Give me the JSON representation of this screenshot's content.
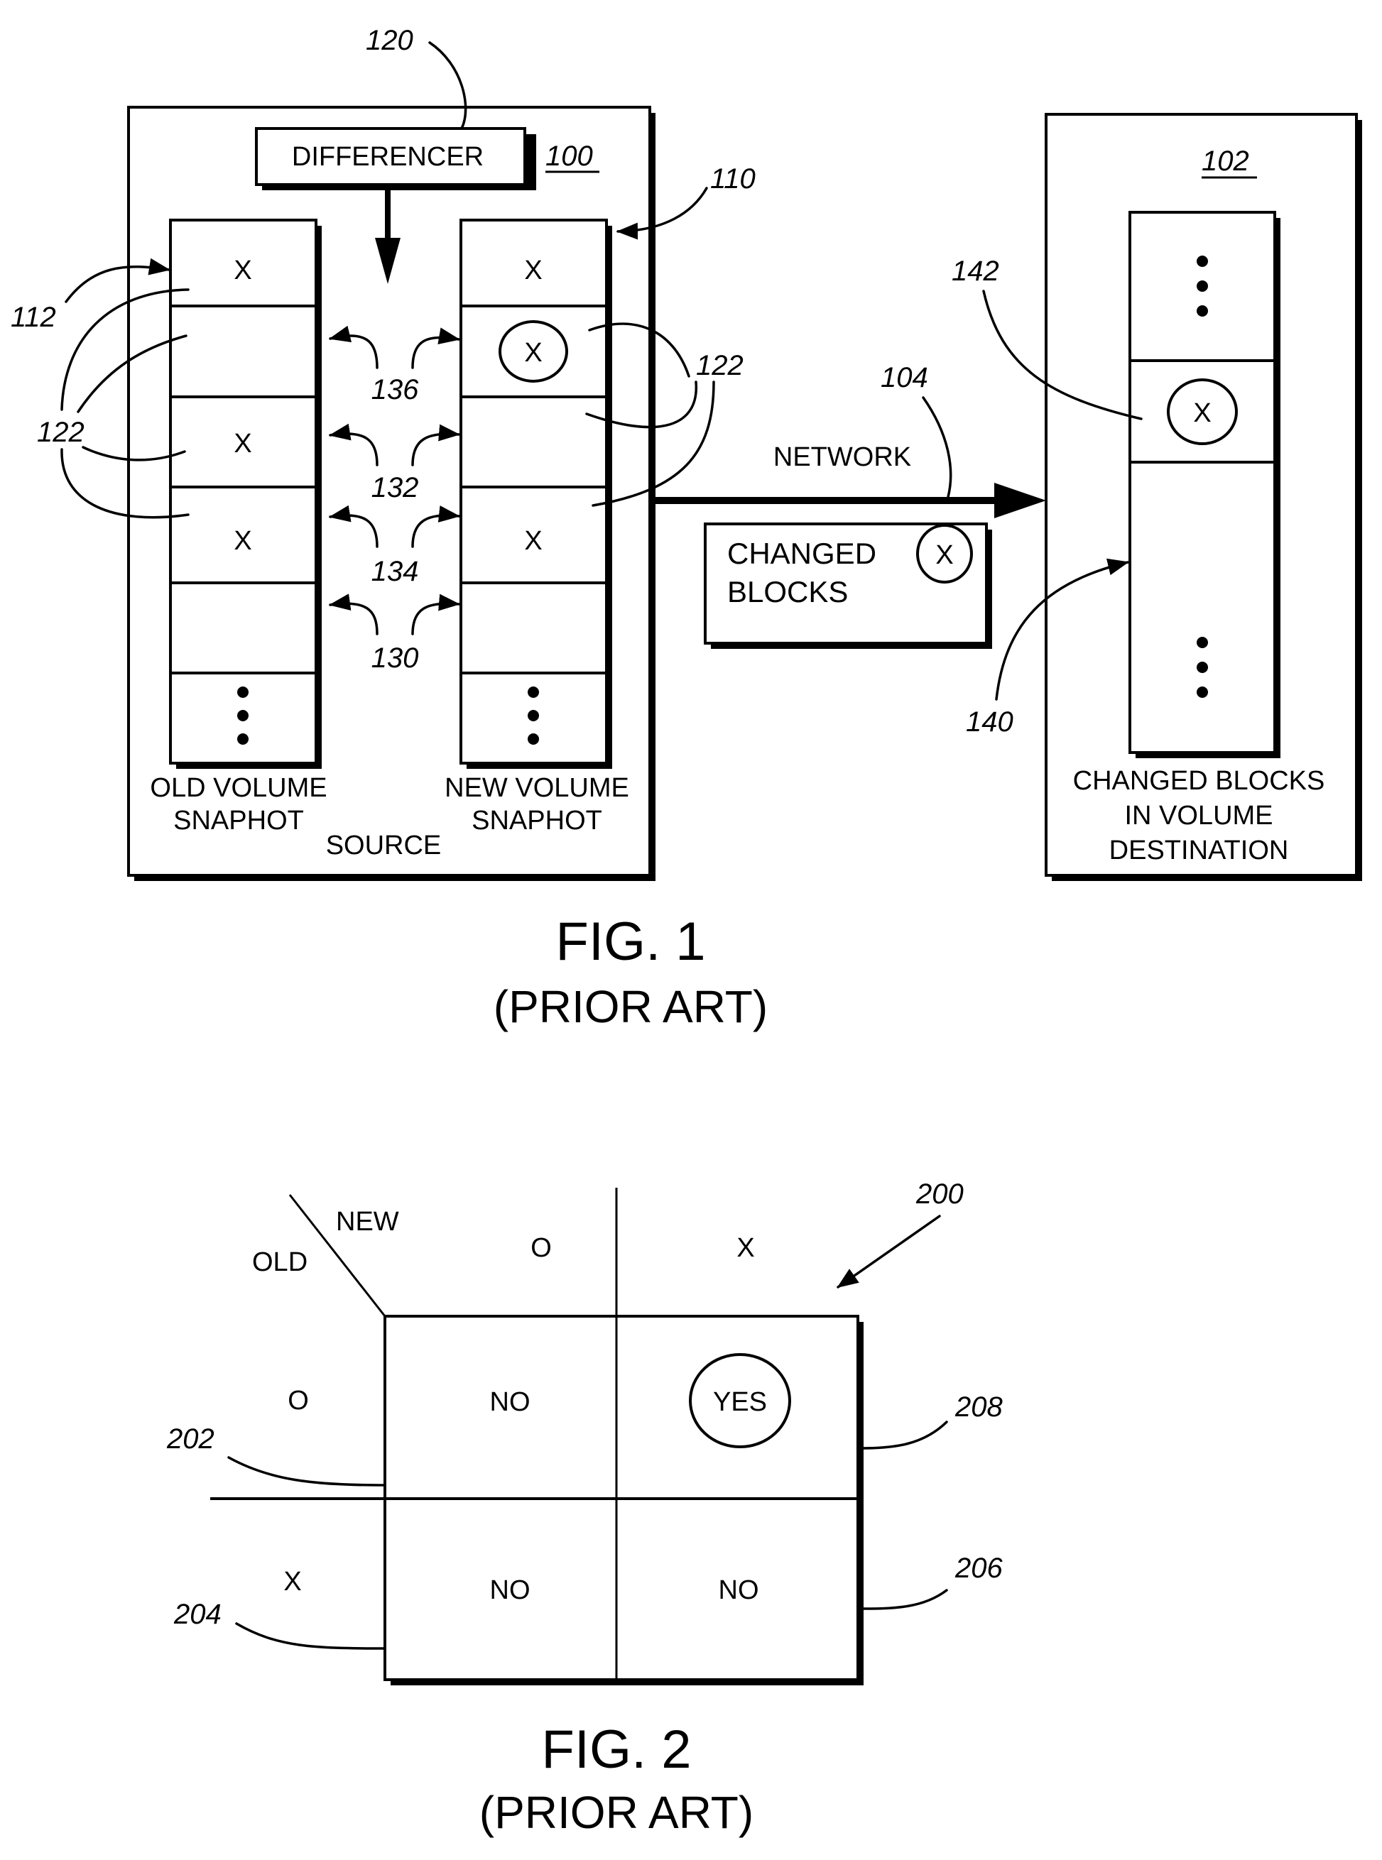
{
  "figure1": {
    "caption": "FIG. 1",
    "subcaption": "(PRIOR ART)",
    "source": {
      "ref": "100",
      "label": "SOURCE",
      "differencer": {
        "label": "DIFFERENCER",
        "ref": "120"
      },
      "old_volume": {
        "label_line1": "OLD VOLUME",
        "label_line2": "SNAPHOT",
        "ref": "112",
        "blocks": [
          "X",
          "",
          "X",
          "X",
          "",
          "⋮"
        ]
      },
      "new_volume": {
        "label_line1": "NEW VOLUME",
        "label_line2": "SNAPHOT",
        "ref": "110",
        "blocks": [
          "X",
          "(X)",
          "",
          "X",
          "",
          "⋮"
        ]
      },
      "block_refs": {
        "left": "122",
        "right": "122"
      },
      "comparison_refs": [
        "136",
        "132",
        "134",
        "130"
      ]
    },
    "network": {
      "label": "NETWORK",
      "ref": "104"
    },
    "changed_blocks_box": {
      "line1": "CHANGED",
      "line2": "BLOCKS",
      "marker": "X"
    },
    "destination": {
      "ref": "102",
      "label_line1": "CHANGED BLOCKS",
      "label_line2": "IN VOLUME",
      "label_line3": "DESTINATION",
      "changed_block_marker": "X",
      "changed_block_ref": "142",
      "volume_ref": "140"
    }
  },
  "figure2": {
    "caption": "FIG. 2",
    "subcaption": "(PRIOR ART)",
    "ref": "200",
    "header_new": "NEW",
    "header_old": "OLD",
    "col_headers": [
      "O",
      "X"
    ],
    "row_headers": [
      "O",
      "X"
    ],
    "cells": [
      [
        "NO",
        "YES"
      ],
      [
        "NO",
        "NO"
      ]
    ],
    "highlighted_cell": "YES",
    "cell_refs": {
      "top_left": "202",
      "bottom_left": "204",
      "top_right": "208",
      "bottom_right": "206"
    }
  }
}
